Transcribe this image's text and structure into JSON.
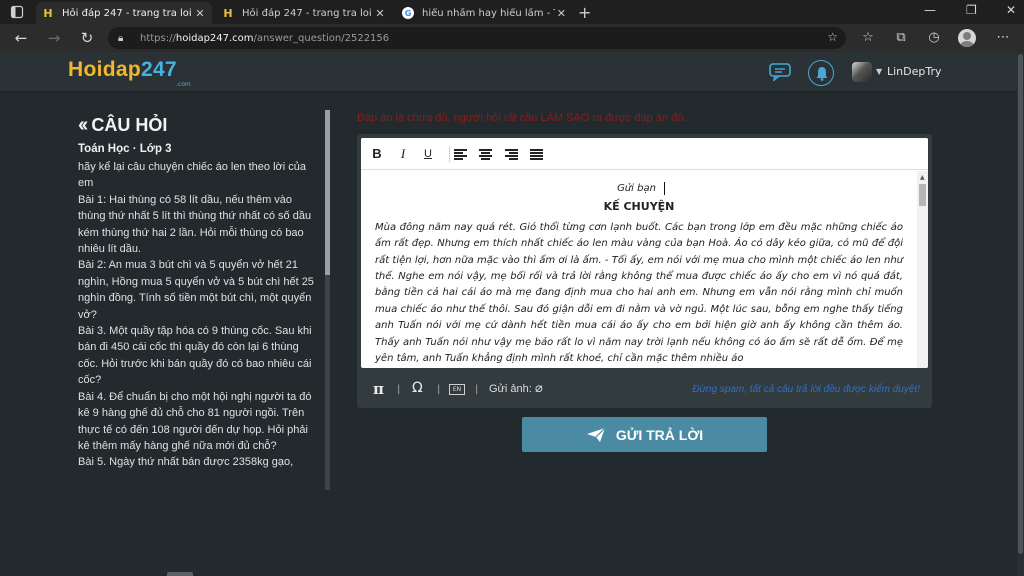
{
  "browser": {
    "tabs": [
      {
        "title": "Hỏi đáp 247 - trang tra loi",
        "favicon": "hoidap-favicon",
        "active": true
      },
      {
        "title": "Hỏi đáp 247 - trang tra loi",
        "favicon": "hoidap-favicon",
        "active": false
      },
      {
        "title": "hiểu nhầm hay hiểu lầm - Tìm tr",
        "favicon": "google-favicon",
        "active": false
      }
    ],
    "url": {
      "scheme": "https://",
      "host": "hoidap247.com",
      "path": "/answer_question/2522156"
    }
  },
  "site": {
    "logo_part1": "Hoidap",
    "logo_part2": "247",
    "logo_sub": ".com",
    "username": "LinDepTry"
  },
  "question": {
    "heading": "CÂU HỎI",
    "meta": "Toán Học · Lớp 3",
    "paragraphs": [
      "hãy kể lại câu chuyện chiếc áo len theo lời của em",
      "Bài 1: Hai thùng có 58 lít dầu, nếu thêm vào thùng thứ nhất 5 lít thì thùng thứ nhất có số dầu kém thùng thứ hai 2 lần. Hỏi mỗi thùng có bao nhiêu lít dầu.",
      "Bài 2: An mua 3 bút chì và 5 quyển vở hết 21 nghìn, Hồng mua 5 quyển vở và 5 bút chì hết 25 nghìn đồng. Tính số tiền một bút chì, một quyển vở?",
      "Bài 3. Một quầy tập hóa có 9 thùng cốc. Sau khi bán đi 450 cái cốc thì quầy đó còn lại 6 thùng cốc. Hỏi trước khi bán quầy đó có bao nhiêu cái cốc?",
      "Bài 4. Để chuẩn bị cho một hội nghị người ta đó kê 9 hàng ghế đủ chỗ cho 81 người ngồi. Trên thực tế có đến 108 người đến dự họp. Hỏi phải kê thêm mấy hàng ghế nữa mới đủ chỗ?",
      "Bài 5. Ngày thứ nhất bán được 2358kg gạo,"
    ]
  },
  "answer": {
    "warning": "Đáp án là chưa đủ, người hỏi rất cần LÀM SAO ra được đáp án đó.",
    "greeting": "Gửi bạn",
    "story_title": "KẾ CHUYỆN",
    "story": "Mùa đông năm nay quá rét. Gió thổi từng cơn lạnh buốt. Các bạn trong lớp em đều mặc những chiếc áo ấm rất đẹp. Nhưng em thích nhất chiếc áo len màu vàng của bạn Hoà. Áo có dây kéo giữa, có mũ để đội rất tiện lợi, hơn nữa mặc vào thì ấm ơi là ấm. - Tối ấy, em nói với mẹ mua cho mình một chiếc áo len như thế. Nghe em nói vậy, mẹ bối rối và trả lời rằng không thể mua được chiếc áo ấy cho em vì nó quá đắt, bằng tiền cả hai cái áo mà mẹ đang định mua cho hai anh em. Nhưng em vẫn nói rằng mình chỉ muốn mua chiếc áo như thế thôi. Sau đó giận dỗi em đi nằm và vờ ngủ. Một lúc sau, bỗng em nghe thấy tiếng anh Tuấn nói với mẹ cứ dành hết tiền mua cái áo ấy cho em bởi hiện giờ anh ấy không cần thêm áo. Thấy anh Tuấn nói như vậy mẹ bảo rất lo vì năm nay trời lạnh nếu không có áo ấm sẽ rất dễ ốm. Để mẹ yên tâm, anh Tuấn khẳng định mình rất khoẻ, chỉ cần mặc thêm nhiều áo",
    "image_label": "Gửi ảnh:",
    "footer_note": "Đừng spam, tất cả câu trả lời đều được kiểm duyệt!",
    "submit_label": "GỬI TRẢ LỜI"
  },
  "colors": {
    "page_bg": "#232a2d",
    "header_bg": "#2a3235",
    "logo_yellow": "#f0b82a",
    "logo_blue": "#43b3e5",
    "warning_red": "#8b1c1c",
    "submit_bg": "#4b8aa3",
    "note_blue": "#2f6fcf"
  }
}
